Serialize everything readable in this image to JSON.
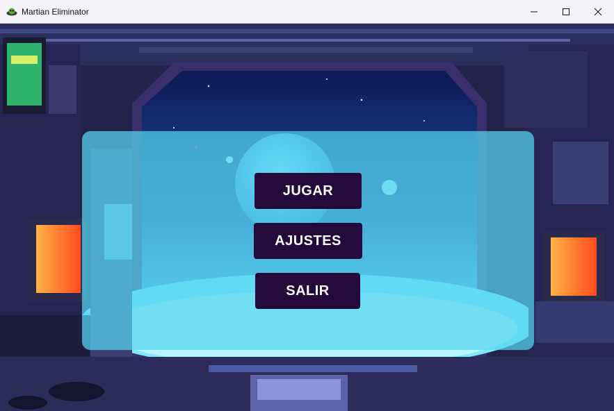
{
  "window": {
    "title": "Martian Eliminator",
    "icon": "alien-app-icon",
    "controls": [
      "minimize-icon",
      "maximize-icon",
      "close-icon"
    ]
  },
  "menu": {
    "play_label": "JUGAR",
    "settings_label": "AJUSTES",
    "exit_label": "SALIR",
    "button_color": "#240a3b",
    "panel_color": "#56d6f0"
  },
  "colors": {
    "scene_dark": "#1a1a40",
    "screen_glow": "#ff6a2a",
    "planet": "#5fd8ff"
  }
}
